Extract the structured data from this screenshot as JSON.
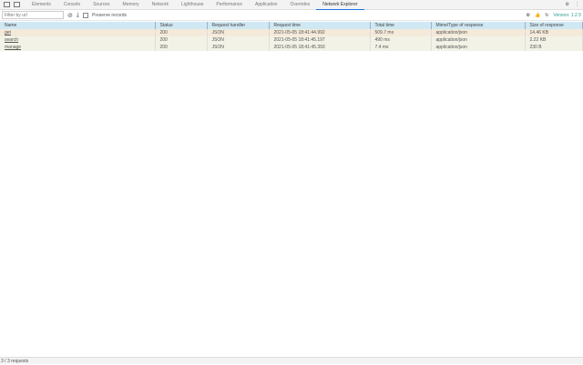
{
  "tabs": [
    "Elements",
    "Console",
    "Sources",
    "Memory",
    "Network",
    "Lighthouse",
    "Performance",
    "Application",
    "Overrides",
    "Network Explorer"
  ],
  "active_tab": "Network Explorer",
  "toolbar": {
    "filter_placeholder": "Filter by url",
    "preserve_label": "Preserve records",
    "version": "Version: 1.2.5"
  },
  "table": {
    "headers": [
      "Name",
      "Status",
      "Request handler",
      "Request time",
      "Total time",
      "Mime/Type of response",
      "Size of response"
    ],
    "rows": [
      [
        "get",
        "200",
        "JSON",
        "2021-05-05 18:41:44.992",
        "509.7 ms",
        "application/json",
        "14.46 KB"
      ],
      [
        "search",
        "200",
        "JSON",
        "2021-05-05 18:41:45.197",
        "490 ms",
        "application/json",
        "2.22 KB"
      ],
      [
        "manage",
        "200",
        "JSON",
        "2021-05-05 18:41:45.393",
        "7.4 ms",
        "application/json",
        "230 B"
      ]
    ]
  },
  "footer": "3 / 3 requests",
  "colors": {
    "header": "#cfe8f3",
    "row_odd": "#f4ead9",
    "row_even": "#f3f2e6",
    "accent": "#1a73e8"
  }
}
